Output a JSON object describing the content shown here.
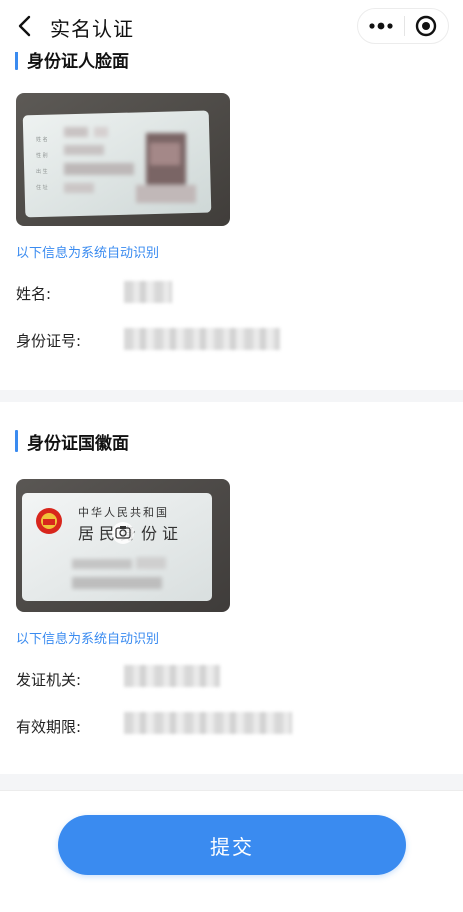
{
  "nav": {
    "title": "实名认证"
  },
  "front_section": {
    "title": "身份证人脸面",
    "auto_note": "以下信息为系统自动识别",
    "fields": [
      {
        "label": "姓名:"
      },
      {
        "label": "身份证号:"
      }
    ]
  },
  "back_section": {
    "title": "身份证国徽面",
    "card_title": "中华人民共和国",
    "card_subtitle": "居民身份证",
    "auto_note": "以下信息为系统自动识别",
    "fields": [
      {
        "label": "发证机关:"
      },
      {
        "label": "有效期限:"
      }
    ]
  },
  "footer": {
    "submit_label": "提交"
  },
  "colors": {
    "accent": "#3a8bf0",
    "background": "#f4f5f7",
    "emblem_red": "#d8261c"
  }
}
